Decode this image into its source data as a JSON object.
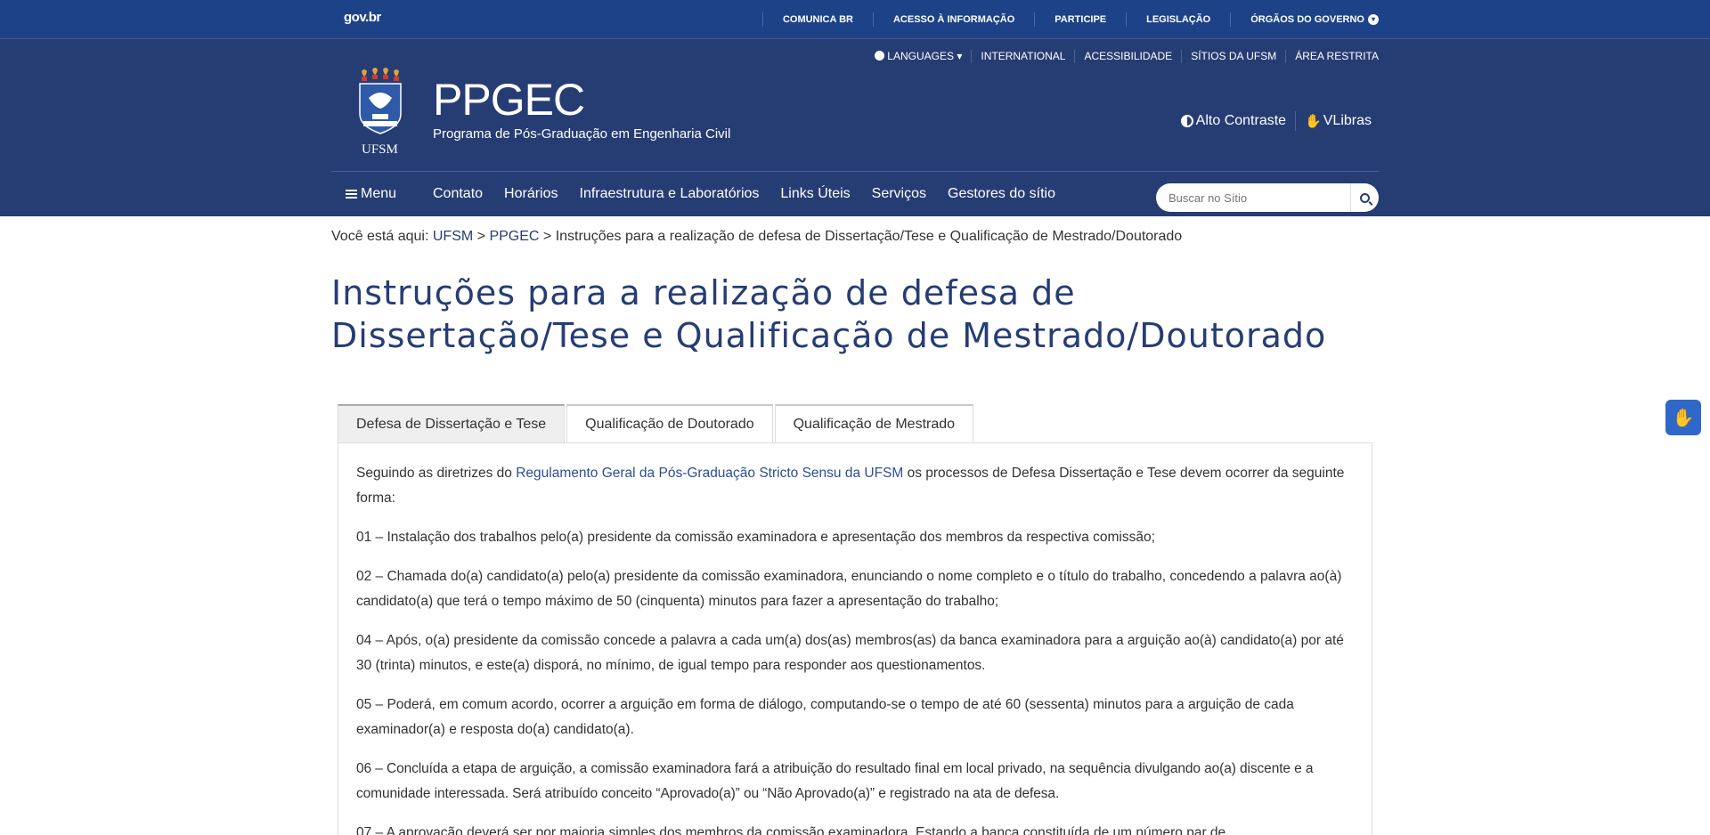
{
  "govbar": {
    "logo": "gov.br",
    "links": [
      "COMUNICA BR",
      "ACESSO À INFORMAÇÃO",
      "PARTICIPE",
      "LEGISLAÇÃO",
      "ÓRGÃOS DO GOVERNO"
    ]
  },
  "header": {
    "top_links": {
      "languages": "LANGUAGES",
      "international": "INTERNATIONAL",
      "accessibility": "ACESSIBILIDADE",
      "sites": "SÍTIOS DA UFSM",
      "restricted": "ÁREA RESTRITA"
    },
    "crest_text": "UFSM",
    "title": "PPGEC",
    "subtitle": "Programa de Pós-Graduação em Engenharia Civil",
    "high_contrast": "Alto Contraste",
    "vlibras": "VLibras",
    "colors": {
      "gov_blue": "#1d4288",
      "header_blue": "#263d74"
    }
  },
  "nav": {
    "menu": "Menu",
    "items": [
      "Contato",
      "Horários",
      "Infraestrutura e Laboratórios",
      "Links Úteis",
      "Serviços",
      "Gestores do sítio"
    ],
    "search_placeholder": "Buscar no Sítio"
  },
  "breadcrumb": {
    "prefix": "Você está aqui:",
    "items": [
      "UFSM",
      "PPGEC"
    ],
    "current": "Instruções para a realização de defesa de Dissertação/Tese e Qualificação de Mestrado/Doutorado"
  },
  "page_title": "Instruções para a realização de defesa de Dissertação/Tese e Qualificação de Mestrado/Doutorado",
  "tabs": [
    "Defesa de Dissertação e Tese",
    "Qualificação de Doutorado",
    "Qualificação de Mestrado"
  ],
  "panel": {
    "intro_before": "Seguindo as diretrizes do ",
    "intro_link": "Regulamento Geral da Pós-Graduação Stricto Sensu da UFSM",
    "intro_after": " os processos de Defesa Dissertação e Tese devem ocorrer da seguinte forma:",
    "items": [
      "01 – Instalação dos trabalhos pelo(a) presidente da comissão examinadora e apresentação dos membros da respectiva comissão;",
      "02 – Chamada do(a) candidato(a) pelo(a) presidente da comissão examinadora, enunciando o nome completo e o título do trabalho, concedendo a palavra ao(à) candidato(a) que terá o tempo máximo de 50 (cinquenta) minutos para fazer a apresentação do trabalho;",
      "04 – Após, o(a) presidente da comissão concede a palavra a cada um(a) dos(as) membros(as) da banca examinadora para a arguição ao(à) candidato(a) por até 30 (trinta) minutos, e este(a) disporá, no mínimo, de igual tempo para responder aos questionamentos.",
      "05 – Poderá, em comum acordo, ocorrer a arguição em forma de diálogo, computando-se o tempo de até 60 (sessenta) minutos para a arguição de cada examinador(a) e resposta do(a) candidato(a).",
      "06 – Concluída a etapa de arguição, a comissão examinadora fará a atribuição do resultado final em local privado, na sequência divulgando ao(a) discente e a comunidade interessada. Será atribuído conceito “Aprovado(a)” ou “Não Aprovado(a)” e registrado na ata de defesa.",
      "07 – A aprovação deverá ser por maioria simples dos membros da comissão examinadora. Estando a banca constituída de um número par de"
    ]
  }
}
